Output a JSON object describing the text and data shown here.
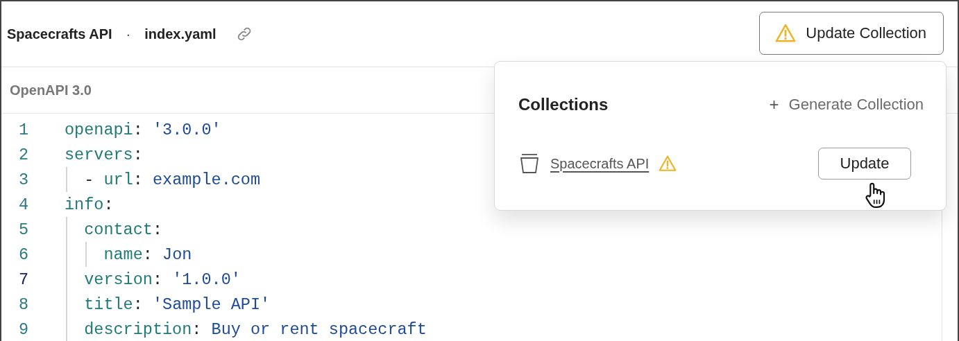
{
  "header": {
    "breadcrumb": [
      "Spacecrafts API",
      "·",
      "index.yaml"
    ],
    "update_button": "Update Collection"
  },
  "editor": {
    "subtitle": "OpenAPI 3.0",
    "lines": [
      {
        "number": "1",
        "current": false,
        "tokens": [
          {
            "kind": "key",
            "text": "openapi"
          },
          {
            "kind": "punct",
            "text": ": "
          },
          {
            "kind": "value",
            "text": "'3.0.0'"
          }
        ]
      },
      {
        "number": "2",
        "current": false,
        "tokens": [
          {
            "kind": "key",
            "text": "servers"
          },
          {
            "kind": "punct",
            "text": ":"
          }
        ],
        "children": [
          {
            "number": "3",
            "current": false,
            "tokens": [
              {
                "kind": "punct",
                "text": "- "
              },
              {
                "kind": "key",
                "text": "url"
              },
              {
                "kind": "punct",
                "text": ": "
              },
              {
                "kind": "value",
                "text": "example.com"
              }
            ]
          }
        ]
      },
      {
        "number": "4",
        "current": false,
        "tokens": [
          {
            "kind": "key",
            "text": "info"
          },
          {
            "kind": "punct",
            "text": ":"
          }
        ],
        "children": [
          {
            "number": "5",
            "current": false,
            "tokens": [
              {
                "kind": "key",
                "text": "contact"
              },
              {
                "kind": "punct",
                "text": ":"
              }
            ],
            "children": [
              {
                "number": "6",
                "current": false,
                "tokens": [
                  {
                    "kind": "key",
                    "text": "name"
                  },
                  {
                    "kind": "punct",
                    "text": ": "
                  },
                  {
                    "kind": "value",
                    "text": "Jon"
                  }
                ]
              }
            ]
          },
          {
            "number": "7",
            "current": true,
            "tokens": [
              {
                "kind": "key",
                "text": "version"
              },
              {
                "kind": "punct",
                "text": ": "
              },
              {
                "kind": "value",
                "text": "'1.0.0'"
              }
            ]
          },
          {
            "number": "8",
            "current": false,
            "tokens": [
              {
                "kind": "key",
                "text": "title"
              },
              {
                "kind": "punct",
                "text": ": "
              },
              {
                "kind": "value",
                "text": "'Sample API'"
              }
            ]
          },
          {
            "number": "9",
            "current": false,
            "tokens": [
              {
                "kind": "key",
                "text": "description"
              },
              {
                "kind": "punct",
                "text": ": "
              },
              {
                "kind": "value",
                "text": "Buy or rent spacecraft"
              }
            ]
          }
        ]
      }
    ]
  },
  "popover": {
    "title": "Collections",
    "generate_icon": "+",
    "generate_label": "Generate Collection",
    "collections": [
      {
        "name": "Spacecrafts API",
        "warning": true,
        "action": "Update"
      }
    ]
  }
}
